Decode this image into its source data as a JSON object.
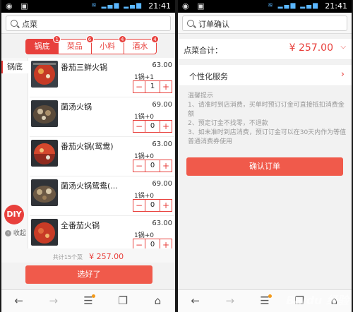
{
  "status_bar": {
    "time": "21:41"
  },
  "left": {
    "search": {
      "text": "点菜"
    },
    "tabs": [
      {
        "label": "锅底",
        "badge": "1"
      },
      {
        "label": "菜品",
        "badge": "6"
      },
      {
        "label": "小料",
        "badge": "4"
      },
      {
        "label": "酒水",
        "badge": "4"
      }
    ],
    "category": "锅底",
    "items": [
      {
        "name": "番茄三鲜火锅",
        "price": "63.00",
        "unit": "1锅+1",
        "qty": "1"
      },
      {
        "name": "菌汤火锅",
        "price": "69.00",
        "unit": "1锅+0",
        "qty": "0"
      },
      {
        "name": "番茄火锅(鸳鸯)",
        "price": "63.00",
        "unit": "1锅+0",
        "qty": "0"
      },
      {
        "name": "菌汤火锅鸳鸯(...",
        "price": "69.00",
        "unit": "1锅+0",
        "qty": "0"
      },
      {
        "name": "全番茄火锅",
        "price": "63.00",
        "unit": "1锅+0",
        "qty": "0"
      }
    ],
    "diy_label": "DIY",
    "collapse_label": "收起",
    "summary": {
      "count": "共计15个菜",
      "total": "¥ 257.00"
    },
    "select_button": "选好了"
  },
  "right": {
    "search": {
      "text": "订单确认"
    },
    "total_label": "点菜合计：",
    "total_value": "¥ 257.00",
    "service_label": "个性化服务",
    "tips_title": "温馨提示",
    "tips": [
      "1、请准时到店消费，买单时预订订金可直接抵扣消费金额",
      "2、预定订金不找零，不退款",
      "3、如未准时到店消费，预订订金可以在30天内作为等值普通消费券使用"
    ],
    "confirm_button": "确认订单"
  },
  "nav_icons": [
    "back-arrow-icon",
    "forward-arrow-icon",
    "menu-icon",
    "tabs-icon",
    "home-icon"
  ],
  "watermark": "Baidu 经验",
  "colors": {
    "accent": "#e8403c",
    "button": "#f05a4b",
    "nav_dot": "#f39a1b"
  }
}
